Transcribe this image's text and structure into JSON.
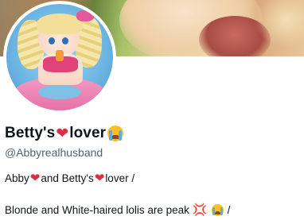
{
  "profile": {
    "display_name": "Betty's",
    "display_name_suffix": "lover",
    "handle": "@Abbyrealhusband"
  },
  "bio": {
    "line1_part1": "Abby",
    "line1_part2": "and Betty's",
    "line1_part3": "lover /",
    "line2_part1": "Blonde and White-haired lolis are peak",
    "line2_part2": "/"
  },
  "icons": {
    "heart": "red-heart-emoji",
    "crying": "loudly-crying-face-emoji",
    "anger": "anger-symbol-emoji",
    "heart_color": "#dd2e44"
  }
}
